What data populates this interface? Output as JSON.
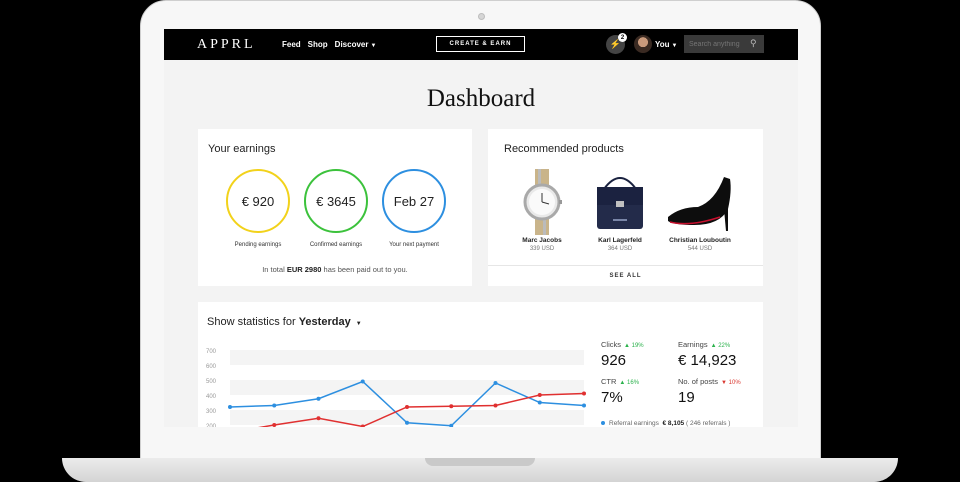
{
  "nav": {
    "brand": "APPRL",
    "links": [
      "Feed",
      "Shop",
      "Discover"
    ],
    "create_label": "CREATE & EARN",
    "notification_count": "2",
    "user_label": "You",
    "search_placeholder": "Search anything"
  },
  "page": {
    "title": "Dashboard"
  },
  "earnings": {
    "title": "Your earnings",
    "items": [
      {
        "value": "€ 920",
        "label": "Pending earnings",
        "color": "#f2d21b"
      },
      {
        "value": "€ 3645",
        "label": "Confirmed earnings",
        "color": "#3cc23c"
      },
      {
        "value": "Feb 27",
        "label": "Your next payment",
        "color": "#2d8fe0"
      }
    ],
    "paid_prefix": "In total ",
    "paid_amount": "EUR 2980",
    "paid_suffix": " has been paid out to you."
  },
  "recommended": {
    "title": "Recommended products",
    "products": [
      {
        "name": "Marc Jacobs",
        "price": "339 USD",
        "icon": "watch-icon"
      },
      {
        "name": "Karl Lagerfeld",
        "price": "364 USD",
        "icon": "handbag-icon"
      },
      {
        "name": "Christian Louboutin",
        "price": "544 USD",
        "icon": "heel-shoe-icon"
      }
    ],
    "see_all": "SEE ALL"
  },
  "stats": {
    "title_prefix": "Show statistics for ",
    "period": "Yesterday",
    "metrics": [
      {
        "label": "Clicks",
        "delta": "19%",
        "direction": "up",
        "value": "926"
      },
      {
        "label": "Earnings",
        "delta": "22%",
        "direction": "up",
        "value": "€ 14,923"
      },
      {
        "label": "CTR",
        "delta": "16%",
        "direction": "up",
        "value": "7%"
      },
      {
        "label": "No. of posts",
        "delta": "10%",
        "direction": "down",
        "value": "19"
      }
    ],
    "referral_label": "Referral earnings",
    "referral_amount": "€ 8,105",
    "referral_count": "( 246 referrals )"
  },
  "chart_data": {
    "type": "line",
    "y_ticks": [
      700,
      600,
      500,
      400,
      300,
      200
    ],
    "ylim": [
      200,
      700
    ],
    "x": [
      0,
      1,
      2,
      3,
      4,
      5,
      6,
      7,
      8
    ],
    "series": [
      {
        "color": "#2d8fe0",
        "values": [
          320,
          330,
          375,
          490,
          215,
          195,
          480,
          350,
          330
        ]
      },
      {
        "color": "#e03030",
        "values": [
          150,
          200,
          245,
          190,
          320,
          325,
          330,
          400,
          410
        ]
      }
    ],
    "grid": true
  }
}
